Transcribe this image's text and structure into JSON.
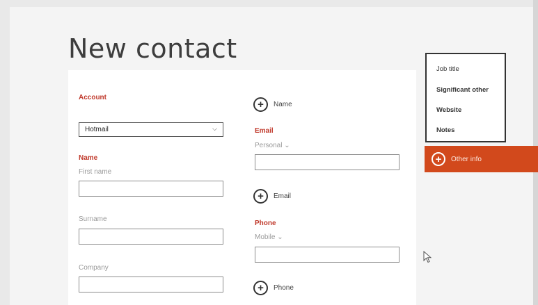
{
  "page": {
    "title": "New contact"
  },
  "account": {
    "section_label": "Account",
    "selected_value": "Hotmail"
  },
  "name_section": {
    "section_label": "Name",
    "first_name_label": "First name",
    "surname_label": "Surname",
    "company_label": "Company"
  },
  "middle": {
    "add_name_label": "Name",
    "email_section_label": "Email",
    "email_field_label": "Personal ⌄",
    "add_email_label": "Email",
    "phone_section_label": "Phone",
    "phone_field_label": "Mobile ⌄",
    "add_phone_label": "Phone"
  },
  "other_info_menu": {
    "items": [
      "Job title",
      "Significant other",
      "Website",
      "Notes"
    ],
    "button_label": "Other info"
  },
  "icons": {
    "plus": "plus-circle-icon",
    "chevron": "chevron-down-icon",
    "cursor": "mouse-pointer-icon"
  },
  "colors": {
    "accent": "#d2491c",
    "section_label": "#c0392b"
  }
}
